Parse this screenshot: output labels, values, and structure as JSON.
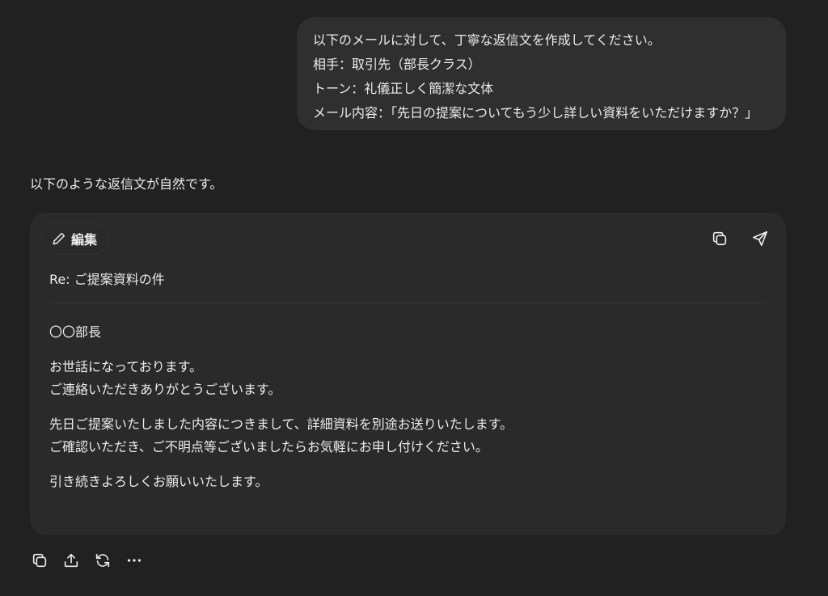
{
  "user_message": {
    "lines": [
      "以下のメールに対して、丁寧な返信文を作成してください。",
      "相手：取引先（部長クラス）",
      "トーン：礼儀正しく簡潔な文体",
      "メール内容：「先日の提案についてもう少し詳しい資料をいただけますか？」"
    ]
  },
  "assistant": {
    "intro": "以下のような返信文が自然です。",
    "card": {
      "edit_label": "編集",
      "subject": "Re: ご提案資料の件",
      "body": {
        "p1": [
          "〇〇部長"
        ],
        "p2": [
          "お世話になっております。",
          "ご連絡いただきありがとうございます。"
        ],
        "p3": [
          "先日ご提案いたしました内容につきまして、詳細資料を別途お送りいたします。",
          "ご確認いただき、ご不明点等ございましたらお気軽にお申し付けください。"
        ],
        "p4": [
          "引き続きよろしくお願いいたします。"
        ]
      },
      "icons": {
        "edit": "pencil-icon",
        "copy": "copy-icon",
        "send": "send-icon"
      }
    },
    "actions": {
      "icons": [
        "copy-icon",
        "share-icon",
        "regenerate-icon",
        "more-icon"
      ]
    }
  },
  "colors": {
    "background": "#212121",
    "bubble": "#2f2f2f",
    "card": "#2a2a2a",
    "text": "#ececec"
  }
}
